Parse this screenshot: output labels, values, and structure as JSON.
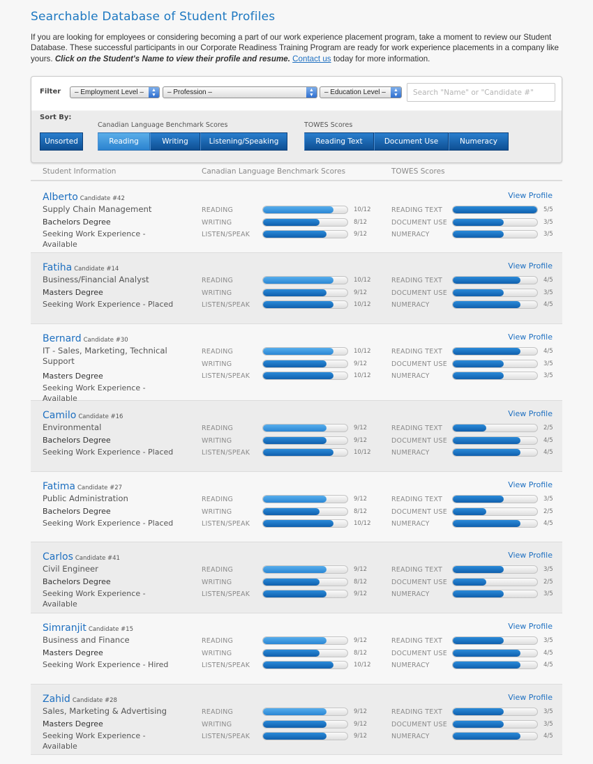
{
  "page": {
    "title": "Searchable Database of Student Profiles",
    "intro_text": "If you are looking for employees or considering becoming a part of our work experience placement program, take a moment to review our Student Database. These successful participants in our Corporate Readiness Training Program are ready for work experience placements in a company like yours.",
    "intro_bold": "Click on the Student's Name to view their profile and resume.",
    "intro_link": "Contact us",
    "intro_tail": "today for more information."
  },
  "filter": {
    "label": "Filter",
    "employment_level": "– Employment Level –",
    "profession": "– Profession –",
    "education_level": "– Education Level –",
    "search_placeholder": "Search \"Name\" or \"Candidate #\"",
    "sort_label": "Sort By:",
    "clb_group_label": "Canadian Language Benchmark Scores",
    "towes_group_label": "TOWES Scores",
    "unsorted": "Unsorted",
    "clb_buttons": [
      "Reading",
      "Writing",
      "Listening/Speaking"
    ],
    "towes_buttons": [
      "Reading Text",
      "Document Use",
      "Numeracy"
    ],
    "active_sort": "Reading"
  },
  "columns": {
    "student": "Student Information",
    "clb": "Canadian Language Benchmark Scores",
    "towes": "TOWES Scores"
  },
  "labels": {
    "clb": [
      "READING",
      "WRITING",
      "LISTEN/SPEAK"
    ],
    "towes": [
      "READING TEXT",
      "DOCUMENT USE",
      "NUMERACY"
    ],
    "view_profile": "View Profile"
  },
  "colors": {
    "accent": "#1d6fc0",
    "bar_dark": "#1060ad",
    "bar_light": "#2a86d4"
  },
  "students": [
    {
      "name": "Alberto",
      "candidate": "Candidate #42",
      "profession": "Supply Chain Management",
      "degree": "Bachelors Degree",
      "status": "Seeking Work Experience - Available",
      "clb": [
        10,
        8,
        9
      ],
      "clb_text": [
        "10/12",
        "8/12",
        "9/12"
      ],
      "towes": [
        5,
        3,
        3
      ],
      "towes_text": [
        "5/5",
        "3/5",
        "3/5"
      ]
    },
    {
      "name": "Fatiha",
      "candidate": "Candidate #14",
      "profession": "Business/Financial Analyst",
      "degree": "Masters Degree",
      "status": "Seeking Work Experience - Placed",
      "clb": [
        10,
        9,
        10
      ],
      "clb_text": [
        "10/12",
        "9/12",
        "10/12"
      ],
      "towes": [
        4,
        3,
        4
      ],
      "towes_text": [
        "4/5",
        "3/5",
        "4/5"
      ]
    },
    {
      "name": "Bernard",
      "candidate": "Candidate #30",
      "profession": "IT - Sales, Marketing, Technical Support",
      "degree": "Masters Degree",
      "status": "Seeking Work Experience - Available",
      "clb": [
        10,
        9,
        10
      ],
      "clb_text": [
        "10/12",
        "9/12",
        "10/12"
      ],
      "towes": [
        4,
        3,
        3
      ],
      "towes_text": [
        "4/5",
        "3/5",
        "3/5"
      ]
    },
    {
      "name": "Camilo",
      "candidate": "Candidate #16",
      "profession": "Environmental",
      "degree": "Bachelors Degree",
      "status": "Seeking Work Experience - Placed",
      "clb": [
        9,
        9,
        10
      ],
      "clb_text": [
        "9/12",
        "9/12",
        "10/12"
      ],
      "towes": [
        2,
        4,
        4
      ],
      "towes_text": [
        "2/5",
        "4/5",
        "4/5"
      ]
    },
    {
      "name": "Fatima",
      "candidate": "Candidate #27",
      "profession": "Public Administration",
      "degree": "Bachelors Degree",
      "status": "Seeking Work Experience - Placed",
      "clb": [
        9,
        8,
        10
      ],
      "clb_text": [
        "9/12",
        "8/12",
        "10/12"
      ],
      "towes": [
        3,
        2,
        4
      ],
      "towes_text": [
        "3/5",
        "2/5",
        "4/5"
      ]
    },
    {
      "name": "Carlos",
      "candidate": "Candidate #41",
      "profession": "Civil Engineer",
      "degree": "Bachelors Degree",
      "status": "Seeking Work Experience - Available",
      "clb": [
        9,
        8,
        9
      ],
      "clb_text": [
        "9/12",
        "8/12",
        "9/12"
      ],
      "towes": [
        3,
        2,
        3
      ],
      "towes_text": [
        "3/5",
        "2/5",
        "3/5"
      ]
    },
    {
      "name": "Simranjit",
      "candidate": "Candidate #15",
      "profession": "Business and Finance",
      "degree": "Masters Degree",
      "status": "Seeking Work Experience - Hired",
      "clb": [
        9,
        8,
        10
      ],
      "clb_text": [
        "9/12",
        "8/12",
        "10/12"
      ],
      "towes": [
        3,
        4,
        4
      ],
      "towes_text": [
        "3/5",
        "4/5",
        "4/5"
      ]
    },
    {
      "name": "Zahid",
      "candidate": "Candidate #28",
      "profession": "Sales, Marketing & Advertising",
      "degree": "Masters Degree",
      "status": "Seeking Work Experience - Available",
      "clb": [
        9,
        9,
        9
      ],
      "clb_text": [
        "9/12",
        "9/12",
        "9/12"
      ],
      "towes": [
        3,
        3,
        4
      ],
      "towes_text": [
        "3/5",
        "3/5",
        "4/5"
      ]
    }
  ]
}
